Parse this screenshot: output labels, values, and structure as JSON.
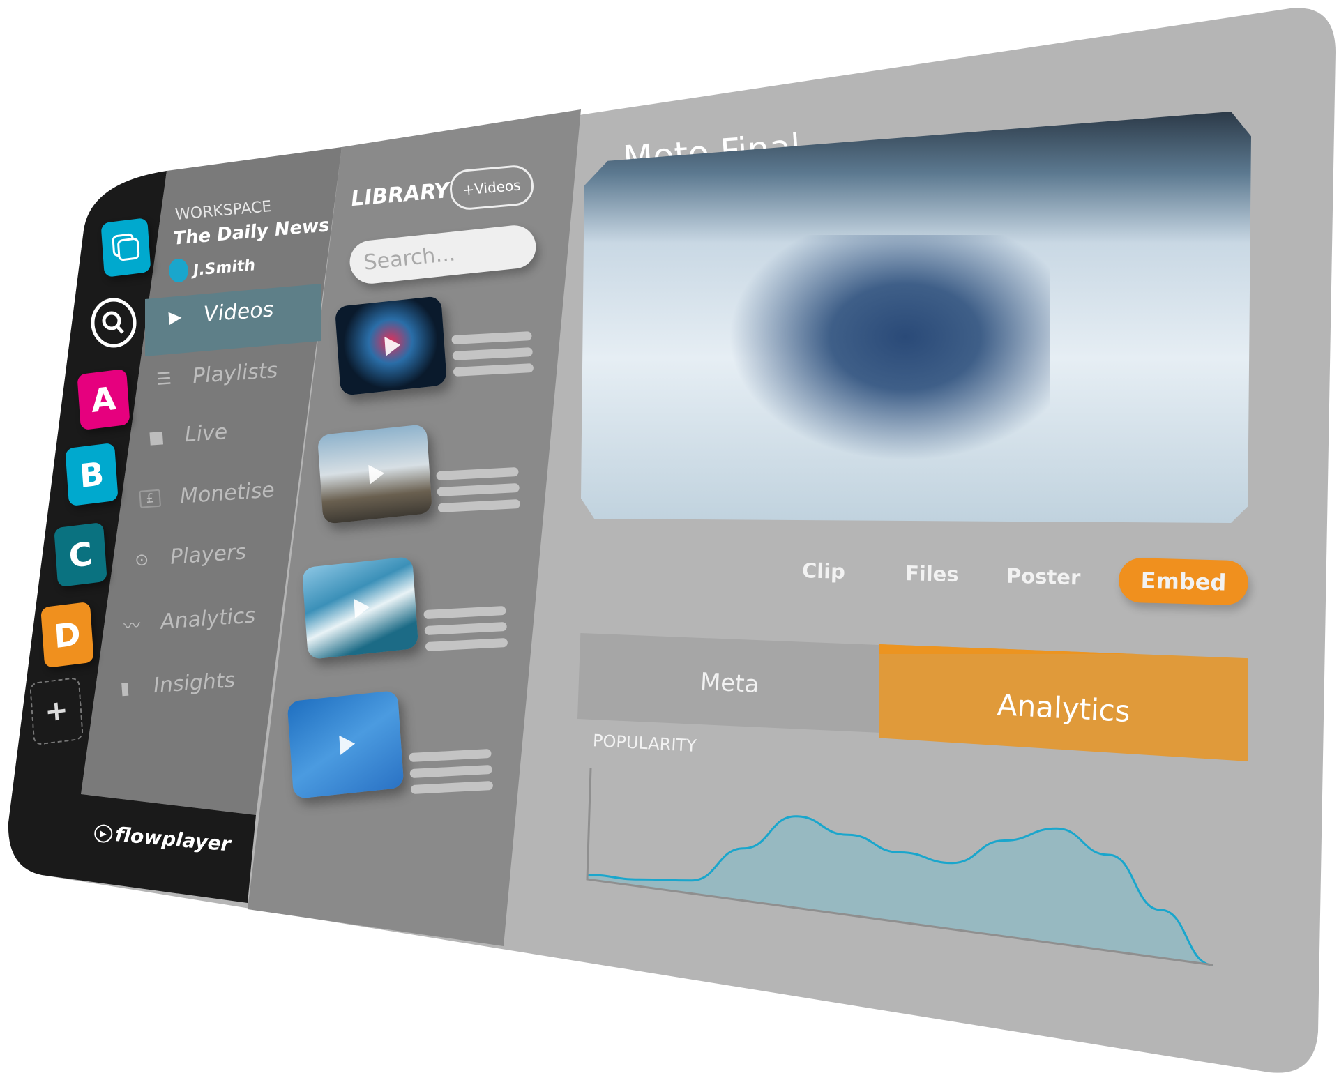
{
  "rail": {
    "items": [
      {
        "label": "",
        "icon": "windows-icon",
        "color": "#00a9ce"
      },
      {
        "label": "",
        "icon": "search-icon",
        "color": "#000000"
      },
      {
        "label": "A",
        "color": "#e6007e"
      },
      {
        "label": "B",
        "color": "#00a9ce"
      },
      {
        "label": "C",
        "color": "#0a7280"
      },
      {
        "label": "D",
        "color": "#f0901e"
      },
      {
        "label": "+",
        "icon": "add-icon"
      }
    ]
  },
  "workspace": {
    "label": "WORKSPACE",
    "name": "The Daily News",
    "user": "J.Smith",
    "user_color": "#1aa6cc"
  },
  "nav": {
    "items": [
      {
        "label": "Videos",
        "icon": "play-icon",
        "active": true
      },
      {
        "label": "Playlists",
        "icon": "list-icon"
      },
      {
        "label": "Live",
        "icon": "camera-icon"
      },
      {
        "label": "Monetise",
        "icon": "pound-icon"
      },
      {
        "label": "Players",
        "icon": "play-circle-icon"
      },
      {
        "label": "Analytics",
        "icon": "trend-icon"
      },
      {
        "label": "Insights",
        "icon": "bar-chart-icon"
      }
    ]
  },
  "logo": "flowplayer",
  "library": {
    "title": "LIBRARY",
    "add_button": "+Videos",
    "search_placeholder": "Search..."
  },
  "main": {
    "title": "Moto Final",
    "tabs": [
      "Clip",
      "Files",
      "Poster",
      "Embed"
    ],
    "active_tab": "Embed",
    "subtabs": [
      "Meta",
      "Analytics"
    ],
    "active_subtab": "Analytics",
    "accent": "#f0901e"
  },
  "chart_data": {
    "type": "area",
    "title": "POPULARITY",
    "xlabel": "",
    "ylabel": "",
    "values": [
      5,
      8,
      15,
      60,
      105,
      92,
      80,
      76,
      110,
      132,
      110,
      55,
      0
    ],
    "grid": false,
    "line_color": "#1aa6cc",
    "fill_color": "#97b9c1"
  }
}
